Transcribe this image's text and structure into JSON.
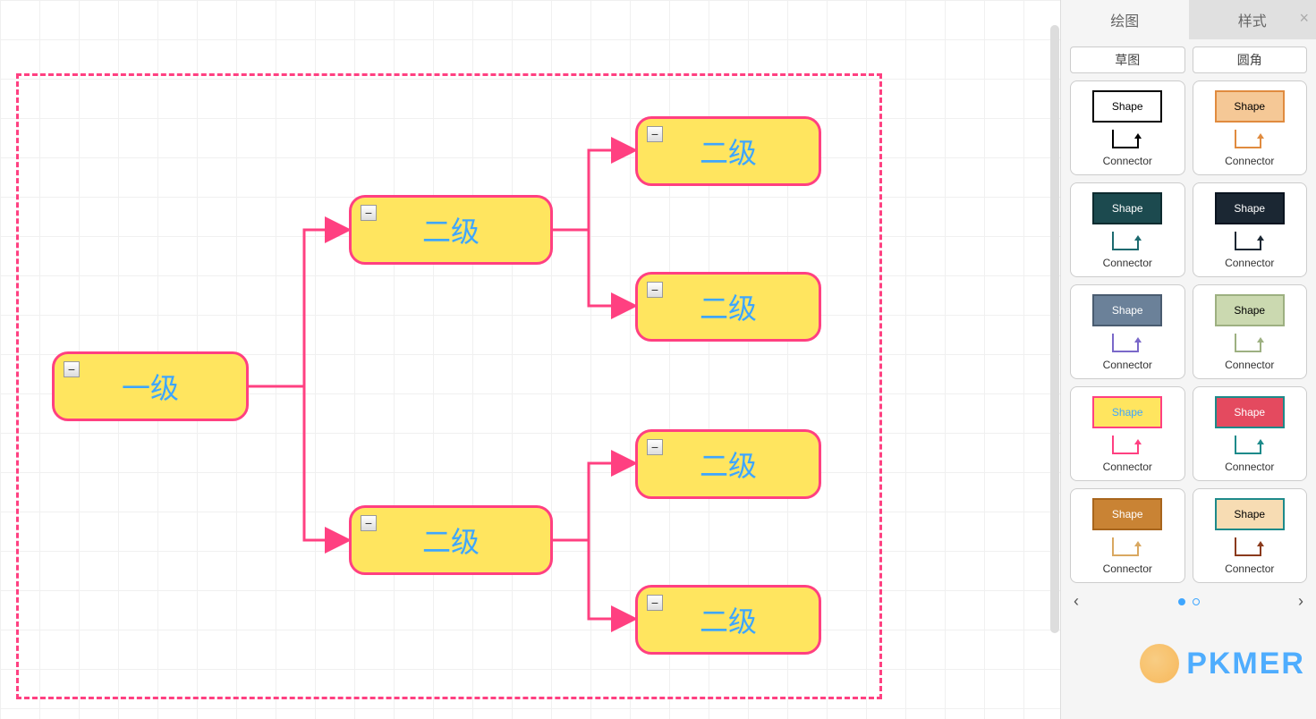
{
  "diagram": {
    "nodes": {
      "root": "一级",
      "l2_1": "二级",
      "l2_2": "二级",
      "l3_1": "二级",
      "l3_2": "二级",
      "l3_3": "二级",
      "l3_4": "二级"
    },
    "collapse_symbol": "−"
  },
  "sidebar": {
    "tabs": {
      "draw": "绘图",
      "style": "样式"
    },
    "close": "×",
    "buttons": {
      "sketch": "草图",
      "rounded": "圆角"
    },
    "preset_labels": {
      "shape": "Shape",
      "connector": "Connector"
    },
    "presets": [
      {
        "fill": "#ffffff",
        "border": "#000000",
        "text": "#000000",
        "conn": "#000000"
      },
      {
        "fill": "#f5c896",
        "border": "#e08b3f",
        "text": "#000000",
        "conn": "#e08b3f"
      },
      {
        "fill": "#1c4a4f",
        "border": "#0d2b2f",
        "text": "#ffffff",
        "conn": "#1c6a6f"
      },
      {
        "fill": "#1b2733",
        "border": "#0a1420",
        "text": "#ffffff",
        "conn": "#1b2733"
      },
      {
        "fill": "#6b8199",
        "border": "#4a5c70",
        "text": "#ffffff",
        "conn": "#7a68c9"
      },
      {
        "fill": "#cbd9b0",
        "border": "#9db081",
        "text": "#000000",
        "conn": "#9db081"
      },
      {
        "fill": "#ffe55f",
        "border": "#ff4081",
        "text": "#3ea6ff",
        "conn": "#ff4081"
      },
      {
        "fill": "#e44a5f",
        "border": "#1d8a8a",
        "text": "#ffffff",
        "conn": "#1d8a8a"
      },
      {
        "fill": "#c98334",
        "border": "#a8651c",
        "text": "#ffffff",
        "conn": "#d9a861"
      },
      {
        "fill": "#f7dcb3",
        "border": "#1d8a8a",
        "text": "#000000",
        "conn": "#8a3a1c"
      }
    ],
    "pager": {
      "prev": "‹",
      "next": "›"
    }
  },
  "watermark": "PKMER"
}
